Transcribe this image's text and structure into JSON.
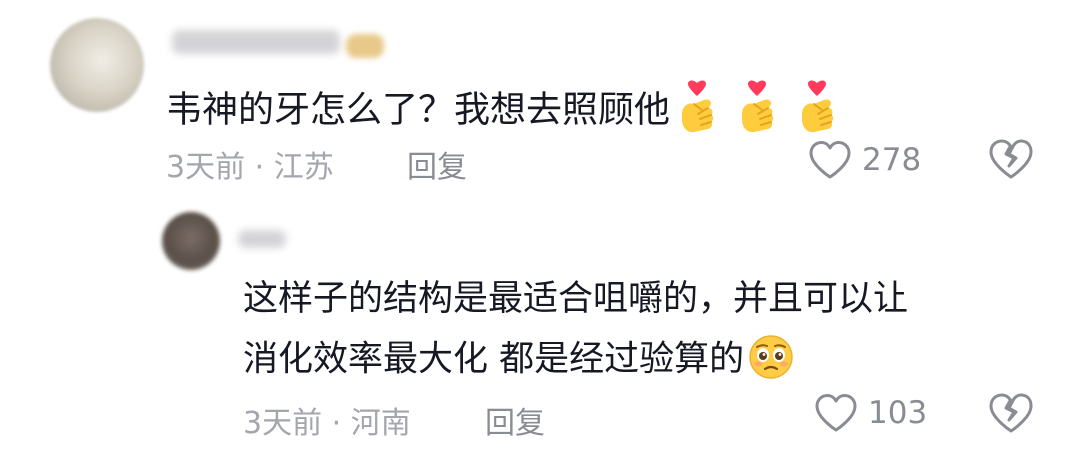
{
  "comment": {
    "text": "韦神的牙怎么了？我想去照顾他",
    "emojis": [
      "finger-heart-emoji",
      "finger-heart-emoji",
      "finger-heart-emoji"
    ],
    "time_location": "3天前 · 江苏",
    "reply_label": "回复",
    "like_count": "278",
    "reply": {
      "line1": "这样子的结构是最适合咀嚼的，并且可以让",
      "line2": "消化效率最大化 都是经过验算的",
      "emoji": "pleading-face-emoji",
      "time_location": "3天前 · 河南",
      "reply_label": "回复",
      "like_count": "103"
    }
  },
  "colors": {
    "text": "#161823",
    "meta": "#a4a6ad",
    "icon": "#8a8c93",
    "heart_pink": "#ff3b5c",
    "hand_yellow": "#ffcc3d"
  }
}
